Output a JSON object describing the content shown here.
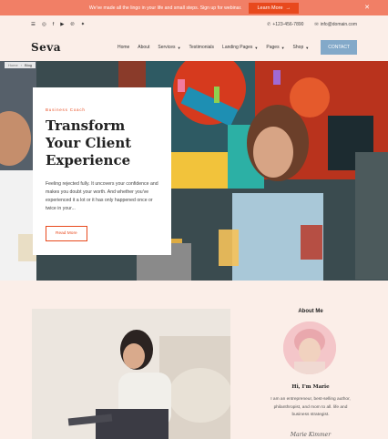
{
  "notice": {
    "text": "We've made all the lingo in your life and small steps. Sign up for webinar.",
    "button": "Learn More",
    "button_icon": "arrow-right-icon",
    "close": "✕"
  },
  "topbar": {
    "social_icons": [
      "menu-icon",
      "instagram-icon",
      "facebook-icon",
      "youtube-icon",
      "pinterest-icon",
      "twitter-icon"
    ],
    "phone": "+123-456-7890",
    "email": "info@domain.com"
  },
  "header": {
    "logo": "Seva",
    "nav": [
      {
        "label": "Home",
        "dropdown": false
      },
      {
        "label": "About",
        "dropdown": false
      },
      {
        "label": "Services",
        "dropdown": true
      },
      {
        "label": "Testimonials",
        "dropdown": false
      },
      {
        "label": "Landing Pages",
        "dropdown": true
      },
      {
        "label": "Pages",
        "dropdown": true
      },
      {
        "label": "Shop",
        "dropdown": true
      }
    ],
    "contact_button": "CONTACT"
  },
  "breadcrumb": {
    "home": "Home",
    "sep": "›",
    "current": "Blog"
  },
  "hero": {
    "eyebrow": "Business Coach",
    "title": "Transform Your Client Experience",
    "description": "Feeling rejected fully. It uncovers your confidence and makes you doubt your worth. And whether you've experienced it a lot or it has only happened once or twice in your...",
    "button": "Read More"
  },
  "about": {
    "title": "About Me",
    "name": "Hi, I'm Marie",
    "bio": "I am an entrepreneur, best-selling author, philanthropist, and mom to all. life and business strategist.",
    "signature": "Marie Kimmer"
  },
  "colors": {
    "accent": "#e8491d",
    "notice_bg": "#f17f66",
    "cream": "#fbeee8",
    "contact_btn": "#83a9c9"
  }
}
